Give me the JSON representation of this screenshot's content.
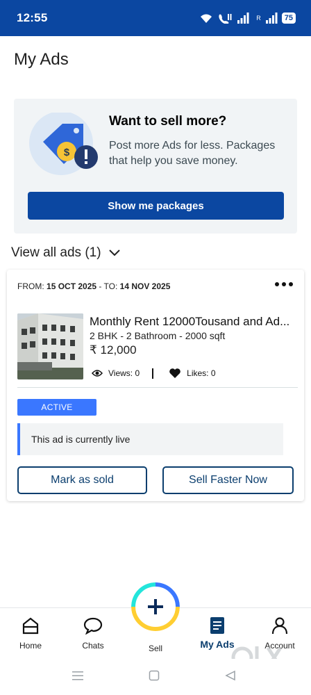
{
  "status_bar": {
    "time": "12:55",
    "battery": "75",
    "carrier_label": "R"
  },
  "page": {
    "title": "My Ads"
  },
  "promo": {
    "heading": "Want to sell more?",
    "text": "Post more Ads for less. Packages that help you save money.",
    "button_label": "Show me packages"
  },
  "view_all": {
    "label": "View all ads (1)"
  },
  "ad": {
    "from_label": "FROM:",
    "from_date": "15 OCT 2025",
    "to_label": "- TO:",
    "to_date": "14 NOV 2025",
    "title": "Monthly Rent 12000Tousand and  Ad...",
    "details": "2 BHK - 2 Bathroom - 2000 sqft",
    "price": "₹ 12,000",
    "views_label": "Views: 0",
    "likes_label": "Likes: 0",
    "status": "ACTIVE",
    "status_message": "This ad is currently live",
    "mark_sold_label": "Mark as sold",
    "sell_faster_label": "Sell Faster Now"
  },
  "bottom_nav": {
    "items": [
      {
        "label": "Home",
        "icon": "home-icon"
      },
      {
        "label": "Chats",
        "icon": "chat-icon"
      },
      {
        "label": "Sell",
        "icon": "plus-icon"
      },
      {
        "label": "My Ads",
        "icon": "my-ads-icon",
        "active": true
      },
      {
        "label": "Account",
        "icon": "account-icon"
      }
    ]
  },
  "colors": {
    "brand_blue": "#0b47a1",
    "accent_blue": "#3a77ff",
    "dark_teal": "#0b3e6e",
    "fab_yellow": "#ffce32",
    "fab_teal": "#23e5db"
  }
}
